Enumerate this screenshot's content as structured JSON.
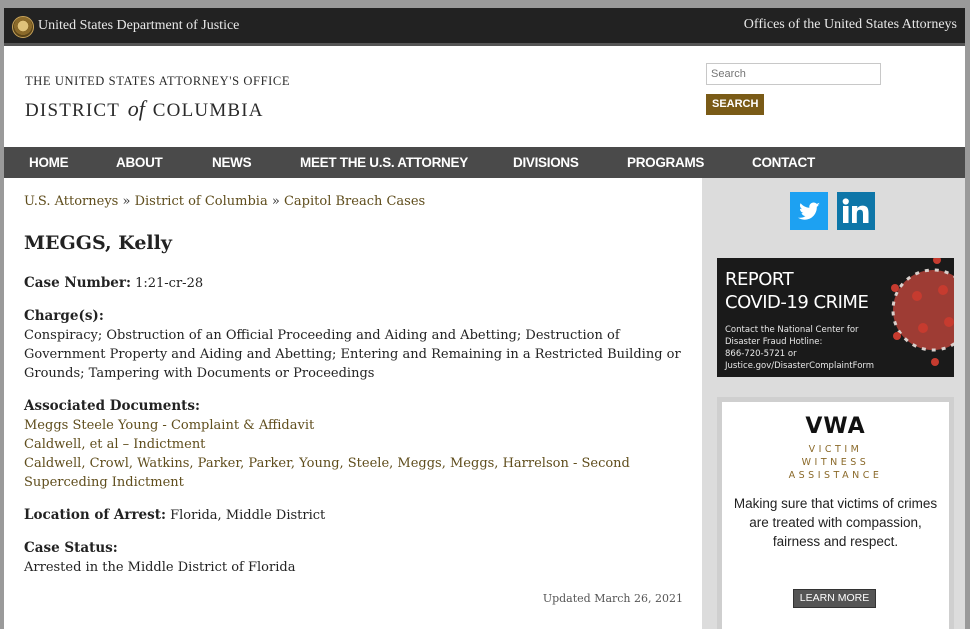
{
  "topbar": {
    "doj_label": "United States Department of Justice",
    "usao_label": "Offices of the United States Attorneys"
  },
  "header": {
    "office_line1": "THE UNITED STATES ATTORNEY'S OFFICE",
    "district_left": "DISTRICT",
    "district_of": "of",
    "district_right": "COLUMBIA"
  },
  "search": {
    "placeholder": "Search",
    "button_label": "SEARCH"
  },
  "nav": {
    "items": [
      "HOME",
      "ABOUT",
      "NEWS",
      "MEET THE U.S. ATTORNEY",
      "DIVISIONS",
      "PROGRAMS",
      "CONTACT"
    ]
  },
  "breadcrumb": {
    "items": [
      "U.S. Attorneys",
      "District of Columbia",
      "Capitol Breach Cases"
    ],
    "separator": "»"
  },
  "page": {
    "title": "MEGGS, Kelly",
    "case_number_label": "Case Number:",
    "case_number": "1:21-cr-28",
    "charges_label": "Charge(s):",
    "charges": "Conspiracy; Obstruction of an Official Proceeding and Aiding and Abetting; Destruction of Government Property and Aiding and Abetting; Entering and Remaining in a Restricted Building or Grounds; Tampering with Documents or Proceedings",
    "documents_label": "Associated Documents:",
    "documents": [
      "Meggs Steele Young - Complaint & Affidavit",
      "Caldwell, et al – Indictment",
      "Caldwell, Crowl, Watkins, Parker, Parker, Young, Steele, Meggs, Meggs, Harrelson - Second Superceding Indictment"
    ],
    "location_label": "Location of Arrest:",
    "location": "Florida, Middle District",
    "status_label": "Case Status:",
    "status": "Arrested in the Middle District of Florida",
    "updated": "Updated March 26, 2021"
  },
  "sidebar": {
    "social": [
      {
        "name": "twitter-icon",
        "color": "#1da1f2"
      },
      {
        "name": "linkedin-icon",
        "color": "#0e76a8"
      }
    ],
    "covid": {
      "title_line1": "REPORT",
      "title_line2": "COVID-19 CRIME",
      "text_line1": "Contact the National Center for",
      "text_line2": "Disaster Fraud Hotline:",
      "text_line3": "866-720-5721 or",
      "text_line4": "Justice.gov/DisasterComplaintForm"
    },
    "vwa": {
      "acronym": "VWA",
      "line1": "VICTIM",
      "line2": "WITNESS",
      "line3": "ASSISTANCE",
      "description": "Making sure that victims of crimes are treated with compassion, fairness and respect.",
      "button_label": "LEARN MORE"
    }
  },
  "colors": {
    "topbar": "#222222",
    "nav": "#4a4a4a",
    "link": "#5f4d1c",
    "search_button": "#7a5b17",
    "sidebar": "#dcdcdc"
  }
}
